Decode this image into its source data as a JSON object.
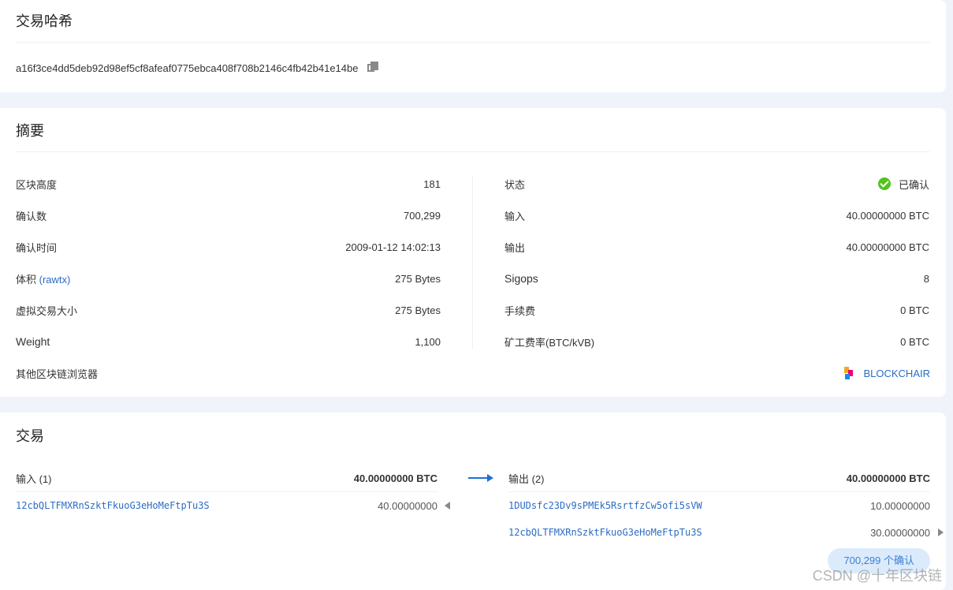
{
  "hash_section": {
    "title": "交易哈希",
    "hash": "a16f3ce4dd5deb92d98ef5cf8afeaf0775ebca408f708b2146c4fb42b41e14be"
  },
  "summary": {
    "title": "摘要",
    "left": [
      {
        "label": "区块高度",
        "value": "181"
      },
      {
        "label": "确认数",
        "value": "700,299"
      },
      {
        "label": "确认时间",
        "value": "2009-01-12 14:02:13"
      },
      {
        "label": "体积",
        "label_link": "(rawtx)",
        "value": "275 Bytes"
      },
      {
        "label": "虚拟交易大小",
        "value": "275 Bytes"
      },
      {
        "label": "Weight",
        "value": "1,100"
      }
    ],
    "right": [
      {
        "label": "状态",
        "value": "已确认"
      },
      {
        "label": "输入",
        "value": "40.00000000 BTC"
      },
      {
        "label": "输出",
        "value": "40.00000000 BTC"
      },
      {
        "label": "Sigops",
        "value": "8"
      },
      {
        "label": "手续费",
        "value": "0 BTC"
      },
      {
        "label": "矿工费率(BTC/kVB)",
        "value": "0 BTC"
      }
    ],
    "other_explorers_label": "其他区块链浏览器",
    "blockchair_label": "BLOCKCHAIR",
    "status_color": "#52c41a",
    "link_color": "#2b6cc4"
  },
  "transaction": {
    "title": "交易",
    "inputs_label": "输入 (1)",
    "inputs_total": "40.00000000 BTC",
    "inputs": [
      {
        "address": "12cbQLTFMXRnSzktFkuoG3eHoMeFtpTu3S",
        "amount": "40.00000000"
      }
    ],
    "outputs_label": "输出 (2)",
    "outputs_total": "40.00000000 BTC",
    "outputs": [
      {
        "address": "1DUDsfc23Dv9sPMEk5RsrtfzCw5ofi5sVW",
        "amount": "10.00000000"
      },
      {
        "address": "12cbQLTFMXRnSzktFkuoG3eHoMeFtpTu3S",
        "amount": "30.00000000"
      }
    ],
    "confirmations_badge": "700,299 个确认"
  },
  "watermark": "CSDN @十年区块链"
}
